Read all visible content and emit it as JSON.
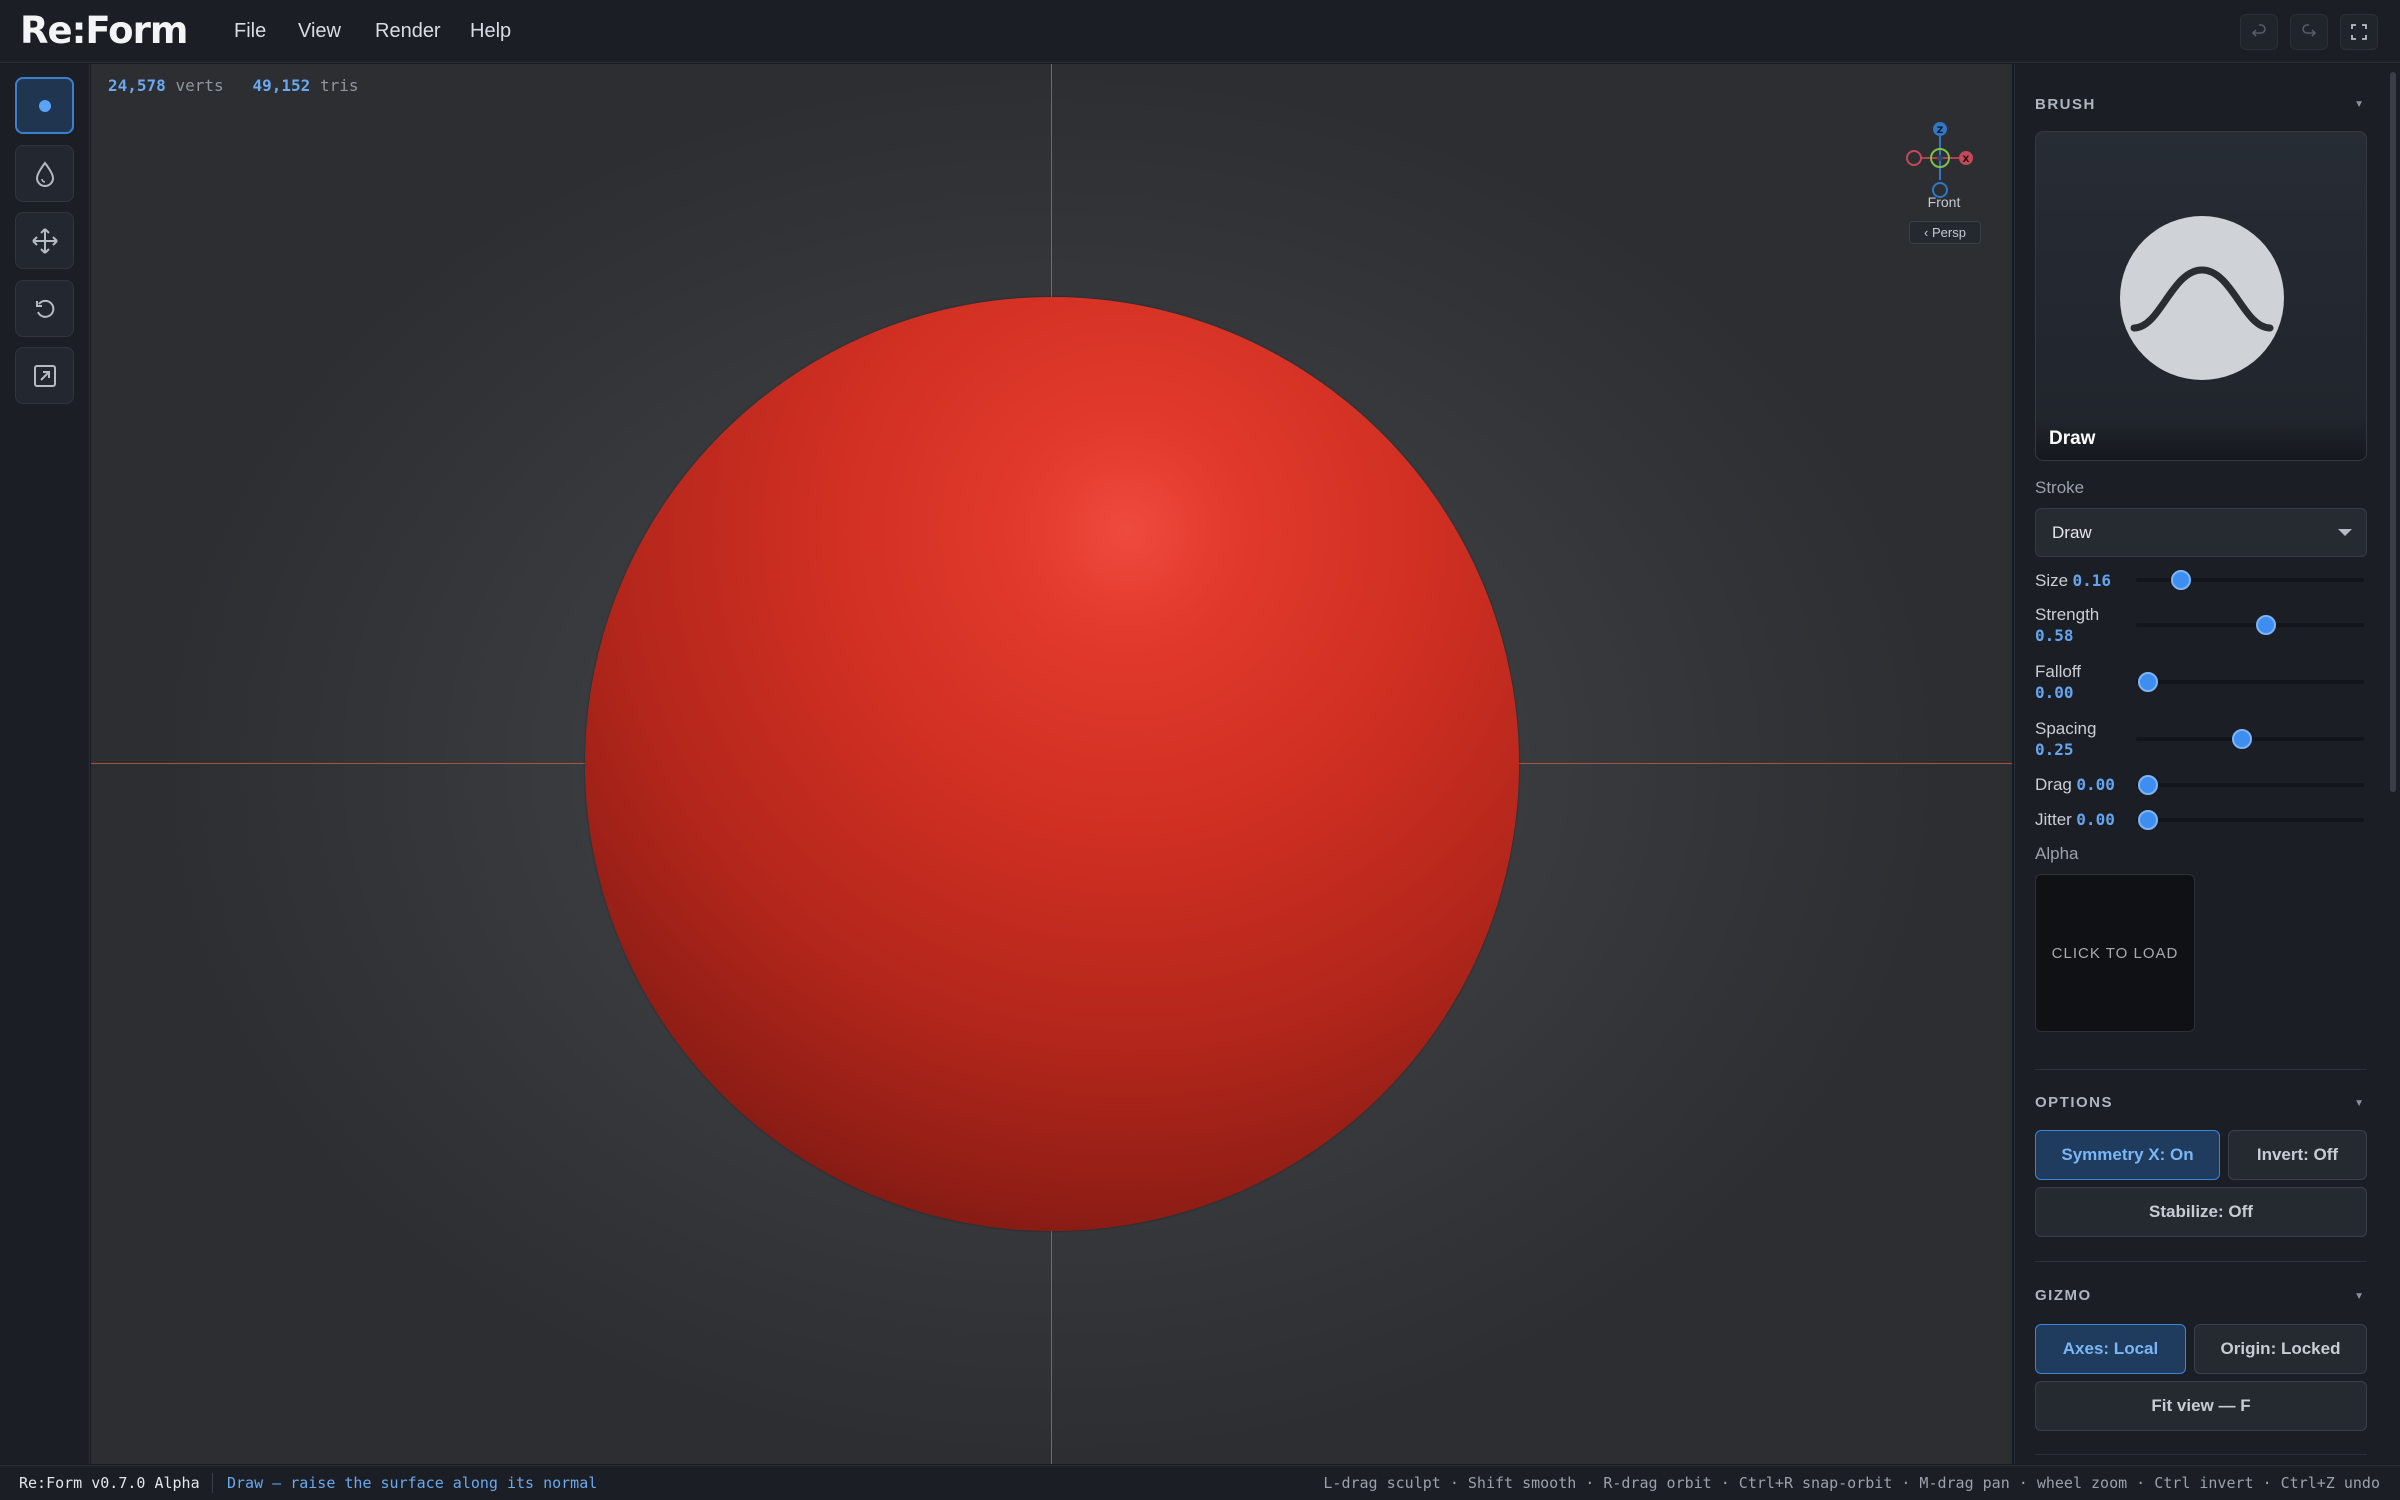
{
  "app": {
    "logo": "Re:Form"
  },
  "menu": [
    "File",
    "View",
    "Render",
    "Help"
  ],
  "window_buttons": [
    {
      "icon": "undo-icon"
    },
    {
      "icon": "redo-icon"
    },
    {
      "icon": "fullscreen-icon"
    }
  ],
  "tools": [
    {
      "name": "draw-tool",
      "icon": "dot-icon",
      "active": true
    },
    {
      "name": "smooth-tool",
      "icon": "drop-icon",
      "active": false
    },
    {
      "name": "move-tool",
      "icon": "move-arrows-icon",
      "active": false
    },
    {
      "name": "rotate-tool",
      "icon": "rotate-icon",
      "active": false
    },
    {
      "name": "export-tool",
      "icon": "export-icon",
      "active": false
    }
  ],
  "viewport": {
    "verts": "24,578",
    "verts_label": "verts",
    "tris": "49,152",
    "tris_label": "tris",
    "view_name": "Front",
    "persp_button": "‹ Persp",
    "gizmo_axes": {
      "z": "Z",
      "x": "X"
    },
    "mesh_color": "#d8342a"
  },
  "panel": {
    "brush": {
      "title": "BRUSH",
      "name": "Draw",
      "stroke_label": "Stroke",
      "stroke_value": "Draw",
      "sliders": [
        {
          "label": "Size",
          "value": "0.16",
          "fraction": 0.16
        },
        {
          "label": "Strength",
          "value": "0.58",
          "fraction": 0.58
        },
        {
          "label": "Falloff",
          "value": "0.00",
          "fraction": 0.0
        },
        {
          "label": "Spacing",
          "value": "0.25",
          "fraction": 0.46
        },
        {
          "label": "Drag",
          "value": "0.00",
          "fraction": 0.0
        },
        {
          "label": "Jitter",
          "value": "0.00",
          "fraction": 0.0
        }
      ],
      "alpha_label": "Alpha",
      "alpha_button": "CLICK TO LOAD"
    },
    "options": {
      "title": "OPTIONS",
      "symmetry": "Symmetry X: On",
      "invert": "Invert: Off",
      "stabilize": "Stabilize: Off"
    },
    "gizmo": {
      "title": "GIZMO",
      "axes": "Axes: Local",
      "origin": "Origin: Locked",
      "fit": "Fit view — F"
    }
  },
  "status": {
    "app": "Re:Form v0.7.0 Alpha",
    "hint": "Draw — raise the surface along its normal",
    "shortcuts": "L-drag sculpt · Shift smooth · R-drag orbit · Ctrl+R snap-orbit · M-drag pan · wheel zoom · Ctrl invert · Ctrl+Z undo"
  },
  "colors": {
    "accent": "#3d8ef0",
    "accent_text": "#6aa8ef",
    "background": "#16191e"
  }
}
